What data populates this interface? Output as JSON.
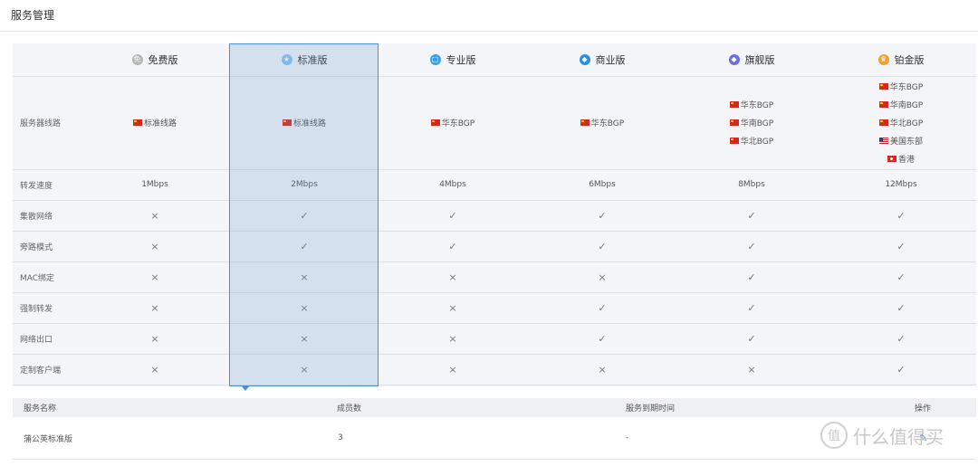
{
  "page": {
    "title": "服务管理"
  },
  "tiers": [
    {
      "name": "免费版",
      "icon": "free-badge-icon",
      "color": "#b5b5b5",
      "symbol": "免"
    },
    {
      "name": "标准版",
      "icon": "star-icon",
      "color": "#8fc4ee",
      "symbol": "★"
    },
    {
      "name": "专业版",
      "icon": "cup-icon",
      "color": "#3aa0e8",
      "symbol": "▢"
    },
    {
      "name": "商业版",
      "icon": "diamond-icon",
      "color": "#2a8fe0",
      "symbol": "◆"
    },
    {
      "name": "旗舰版",
      "icon": "gem-icon",
      "color": "#6a6ee0",
      "symbol": "◆"
    },
    {
      "name": "铂金版",
      "icon": "crown-icon",
      "color": "#f0a030",
      "symbol": "♛"
    }
  ],
  "features": {
    "routes_label": "服务器线路",
    "routes": [
      [
        {
          "flag": "cn",
          "text": "标准线路"
        }
      ],
      [
        {
          "flag": "cn",
          "text": "标准线路"
        }
      ],
      [
        {
          "flag": "cn",
          "text": "华东BGP"
        }
      ],
      [
        {
          "flag": "cn",
          "text": "华东BGP"
        }
      ],
      [
        {
          "flag": "cn",
          "text": "华东BGP"
        },
        {
          "flag": "cn",
          "text": "华南BGP"
        },
        {
          "flag": "cn",
          "text": "华北BGP"
        }
      ],
      [
        {
          "flag": "cn",
          "text": "华东BGP"
        },
        {
          "flag": "cn",
          "text": "华南BGP"
        },
        {
          "flag": "cn",
          "text": "华北BGP"
        },
        {
          "flag": "us",
          "text": "美国东部"
        },
        {
          "flag": "hk",
          "text": "香港"
        }
      ]
    ],
    "speed_label": "转发速度",
    "speeds": [
      "1Mbps",
      "2Mbps",
      "4Mbps",
      "6Mbps",
      "8Mbps",
      "12Mbps"
    ],
    "check_rows": [
      {
        "label": "集散网络",
        "values": [
          false,
          true,
          true,
          true,
          true,
          true
        ]
      },
      {
        "label": "旁路模式",
        "values": [
          false,
          true,
          true,
          true,
          true,
          true
        ]
      },
      {
        "label": "MAC绑定",
        "values": [
          false,
          false,
          false,
          false,
          true,
          true
        ]
      },
      {
        "label": "强制转发",
        "values": [
          false,
          false,
          false,
          true,
          true,
          true
        ]
      },
      {
        "label": "网络出口",
        "values": [
          false,
          false,
          false,
          true,
          true,
          true
        ]
      },
      {
        "label": "定制客户端",
        "values": [
          false,
          false,
          false,
          false,
          false,
          true
        ]
      }
    ]
  },
  "marks": {
    "yes": "✓",
    "no": "×"
  },
  "selected_tier": "标准版",
  "service_table": {
    "headers": {
      "name": "服务名称",
      "members": "成员数",
      "expiry": "服务到期时间",
      "actions": "操作"
    },
    "rows": [
      {
        "name": "蒲公英标准版",
        "members": "3",
        "expiry": "-",
        "action": "edit-icon"
      }
    ]
  },
  "watermark": {
    "symbol": "值",
    "text": "什么值得买"
  }
}
